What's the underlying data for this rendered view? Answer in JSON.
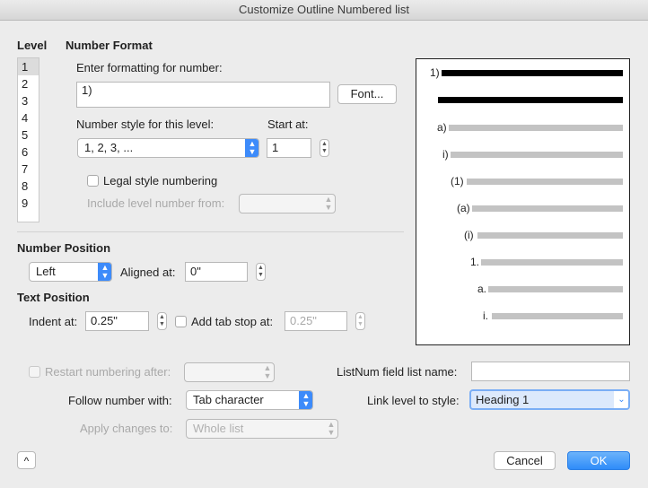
{
  "window": {
    "title": "Customize Outline Numbered list"
  },
  "level": {
    "heading": "Level",
    "items": [
      "1",
      "2",
      "3",
      "4",
      "5",
      "6",
      "7",
      "8",
      "9"
    ],
    "selected": "1"
  },
  "number_format": {
    "heading": "Number Format",
    "enter_label": "Enter formatting for number:",
    "format_value": "1)",
    "font_button": "Font...",
    "style_label": "Number style for this level:",
    "style_value": "1, 2, 3, ...",
    "start_label": "Start at:",
    "start_value": "1",
    "legal_label": "Legal style numbering",
    "legal_checked": false,
    "include_label": "Include level number from:",
    "include_value": ""
  },
  "number_position": {
    "heading": "Number Position",
    "alignment_value": "Left",
    "aligned_label": "Aligned at:",
    "aligned_value": "0\""
  },
  "text_position": {
    "heading": "Text Position",
    "indent_label": "Indent at:",
    "indent_value": "0.25\"",
    "tab_label": "Add tab stop at:",
    "tab_checked": false,
    "tab_value": "0.25\""
  },
  "bottom": {
    "restart_label": "Restart numbering after:",
    "restart_checked": false,
    "restart_value": "",
    "follow_label": "Follow number with:",
    "follow_value": "Tab character",
    "apply_label": "Apply changes to:",
    "apply_value": "Whole list",
    "listnum_label": "ListNum field list name:",
    "listnum_value": "",
    "link_label": "Link level to style:",
    "link_value": "Heading 1"
  },
  "preview": {
    "labels": [
      "1)",
      "a)",
      "i)",
      "(1)",
      "(a)",
      "(i)",
      "1.",
      "a.",
      "i."
    ]
  },
  "buttons": {
    "cancel": "Cancel",
    "ok": "OK",
    "collapse_glyph": "^"
  },
  "colors": {
    "accent": "#3d8bfa",
    "ok_button": "#2f8cf9",
    "preview_line": "#c3c3c3",
    "preview_heading_line": "#000000"
  }
}
